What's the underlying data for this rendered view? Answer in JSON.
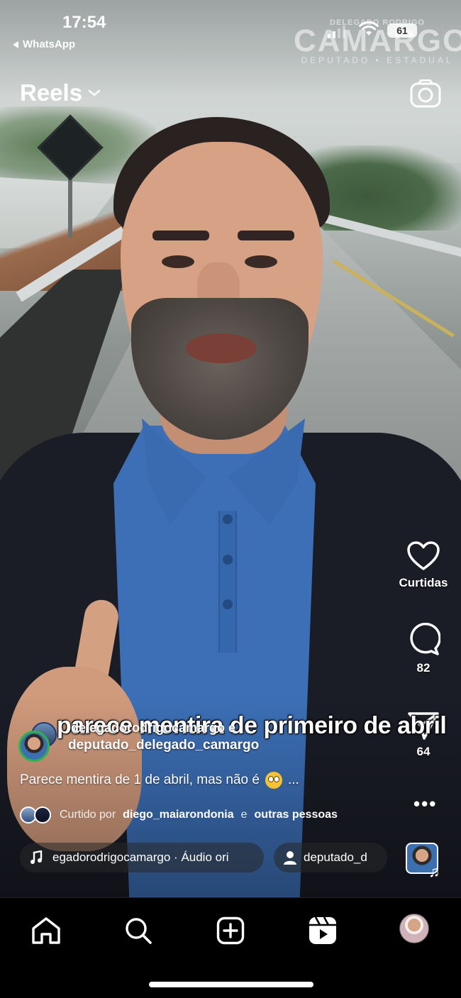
{
  "status_bar": {
    "time": "17:54",
    "back_app": "WhatsApp",
    "battery": "61"
  },
  "watermark": {
    "top": "DELEGADO RODRIGO",
    "main": "CAMARGO",
    "sub": "DEPUTADO • ESTADUAL"
  },
  "header": {
    "title": "Reels",
    "title_icon": "chevron-down-icon",
    "camera_icon": "camera-icon"
  },
  "actions": {
    "like_label": "Curtidas",
    "comment_count": "82",
    "share_count": "64",
    "more_icon": "more-dots-icon"
  },
  "post": {
    "overlay_text": "parece mentira de primeiro de abril",
    "author_1": "delegadorodrigocamargo e",
    "author_2": "deputado_delegado_camargo",
    "caption": "Parece mentira de 1 de abril, mas não é",
    "caption_more": "...",
    "liked_prefix": "Curtido por",
    "liked_user": "diego_maiarondonia",
    "liked_mid": "e",
    "liked_others": "outras pessoas",
    "audio_text": "egadorodrigocamargo · Áudio ori",
    "tag_text": "deputado_d"
  },
  "tabbar": {
    "items": [
      "home-icon",
      "search-icon",
      "create-icon",
      "reels-icon",
      "profile-avatar"
    ]
  },
  "colors": {
    "background": "#000000",
    "text": "#ffffff",
    "pill_bg": "rgba(40,40,40,0.55)"
  }
}
